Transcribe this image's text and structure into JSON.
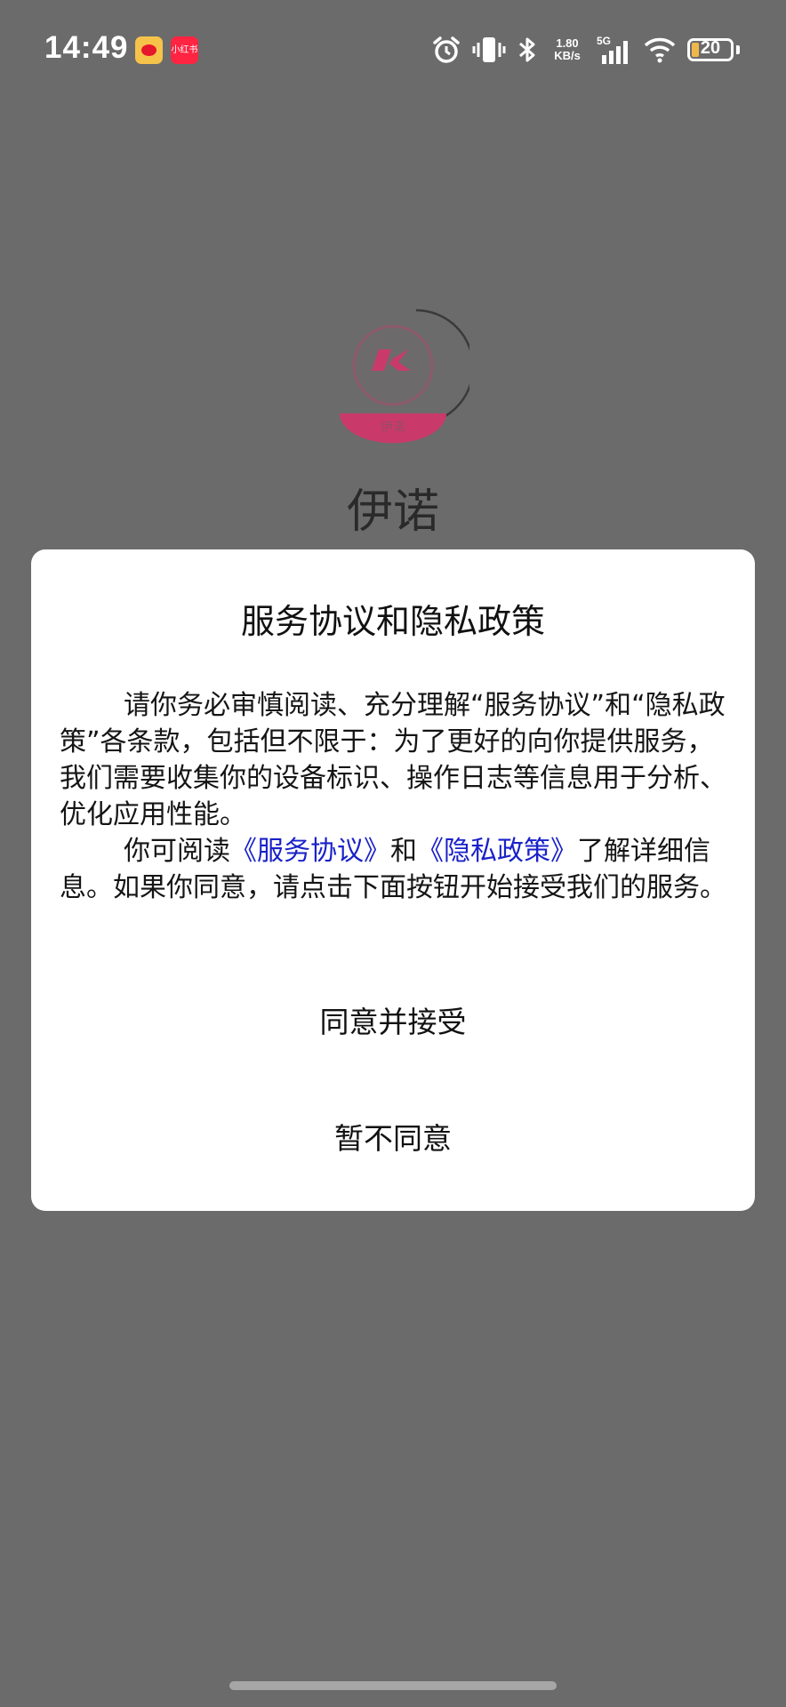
{
  "status_bar": {
    "time": "14:49",
    "xhs_label": "小红书",
    "net_speed_value": "1.80",
    "net_speed_unit": "KB/s",
    "network": "5G",
    "battery": "20",
    "icons": [
      "weibo-icon",
      "xiaohongshu-icon",
      "alarm-icon",
      "vibrate-icon",
      "bluetooth-icon",
      "signal-icon",
      "wifi-icon",
      "battery-icon"
    ]
  },
  "splash": {
    "logo_caption": "伊诺",
    "app_name": "伊诺"
  },
  "dialog": {
    "title": "服务协议和隐私政策",
    "paragraph1": "请你务必审慎阅读、充分理解“服务协议”和“隐私政策”各条款，包括但不限于：为了更好的向你提供服务，我们需要收集你的设备标识、操作日志等信息用于分析、优化应用性能。",
    "p2_prefix": "你可阅读",
    "service_link": "《服务协议》",
    "p2_and": "和",
    "privacy_link": "《隐私政策》",
    "p2_suffix": "了解详细信息。如果你同意，请点击下面按钮开始接受我们的服务。",
    "agree_button": "同意并接受",
    "disagree_button": "暂不同意"
  },
  "colors": {
    "overlay": "#6b6b6b",
    "link": "#1a22c8",
    "logo_accent": "#c93a6b"
  }
}
